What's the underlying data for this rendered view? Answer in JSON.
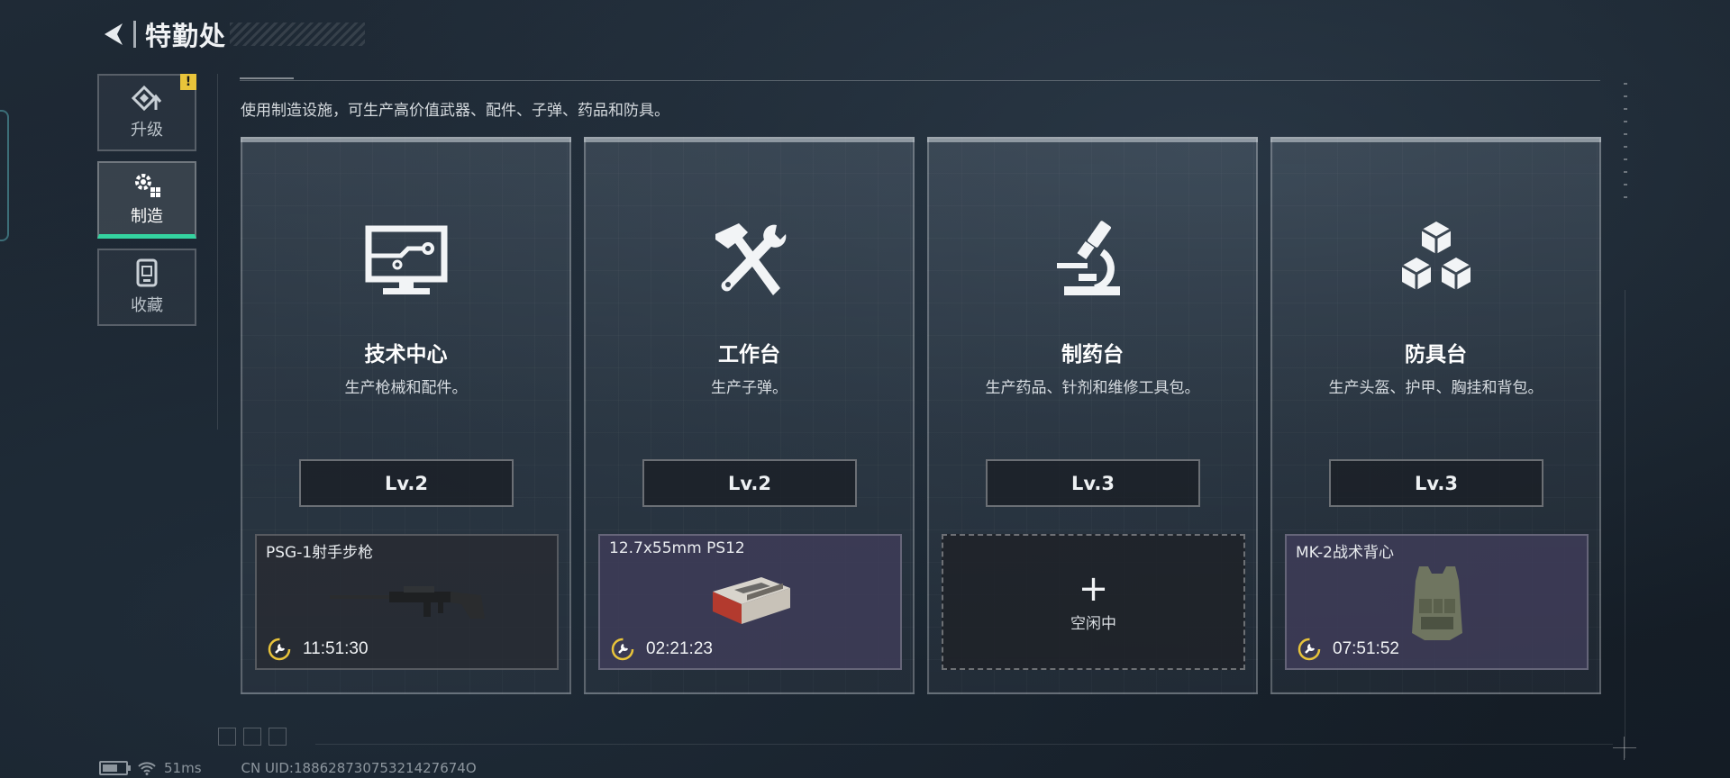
{
  "header": {
    "title": "特勤处"
  },
  "sidenav": {
    "items": [
      {
        "label": "升级",
        "icon": "upgrade-icon",
        "badge": "!"
      },
      {
        "label": "制造",
        "icon": "gears-icon",
        "active": true
      },
      {
        "label": "收藏",
        "icon": "collection-icon"
      }
    ]
  },
  "description": "使用制造设施，可生产高价值武器、配件、子弹、药品和防具。",
  "facilities": [
    {
      "name": "技术中心",
      "desc": "生产枪械和配件。",
      "level": "Lv.2",
      "icon": "monitor-icon",
      "slot": {
        "item": "PSG-1射手步枪",
        "timer": "11:51:30",
        "rarity": "dark",
        "image": "rifle-icon"
      }
    },
    {
      "name": "工作台",
      "desc": "生产子弹。",
      "level": "Lv.2",
      "icon": "hammer-wrench-icon",
      "slot": {
        "item": "12.7x55mm PS12",
        "timer": "02:21:23",
        "rarity": "purple",
        "image": "ammo-box-icon"
      }
    },
    {
      "name": "制药台",
      "desc": "生产药品、针剂和维修工具包。",
      "level": "Lv.3",
      "icon": "microscope-icon",
      "slot": {
        "empty": true,
        "plus": "+",
        "idle": "空闲中"
      }
    },
    {
      "name": "防具台",
      "desc": "生产头盔、护甲、胸挂和背包。",
      "level": "Lv.3",
      "icon": "cubes-icon",
      "slot": {
        "item": "MK-2战术背心",
        "timer": "07:51:52",
        "rarity": "purple",
        "image": "vest-icon"
      }
    }
  ],
  "status": {
    "ping": "51ms",
    "uid": "CN UID:18862873075321427674O"
  },
  "colors": {
    "accent": "#34d3a0",
    "warning": "#e9c43a",
    "timer": "#e9c43a",
    "purple": "#3e3c58"
  }
}
